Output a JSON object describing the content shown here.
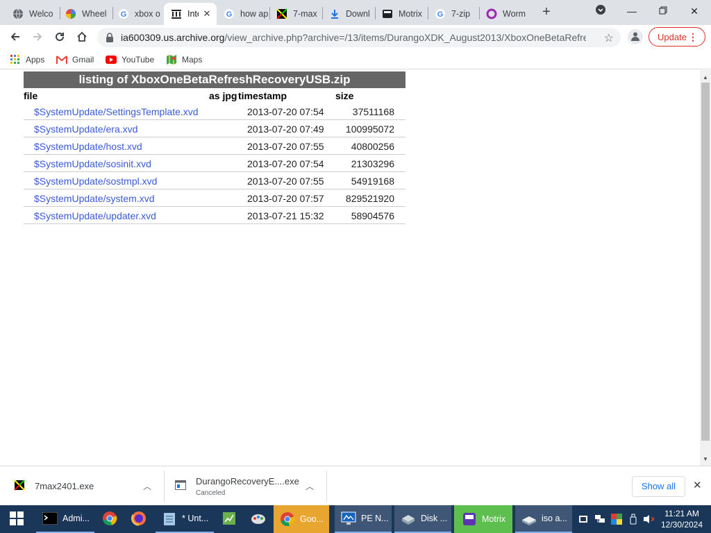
{
  "tabs": [
    {
      "title": "Welco",
      "icon": "globe-icon"
    },
    {
      "title": "Wheel",
      "icon": "wheel-icon"
    },
    {
      "title": "xbox o",
      "icon": "google-icon"
    },
    {
      "title": "Inte",
      "icon": "archive-icon",
      "active": true
    },
    {
      "title": "how ap",
      "icon": "google-icon"
    },
    {
      "title": "7-max",
      "icon": "7max-icon"
    },
    {
      "title": "Downl",
      "icon": "download-icon"
    },
    {
      "title": "Motrix",
      "icon": "motrix-icon"
    },
    {
      "title": "7-zip",
      "icon": "google-icon"
    },
    {
      "title": "Worm",
      "icon": "worm-icon"
    }
  ],
  "address": {
    "host": "ia600309.us.archive.org",
    "path": "/view_archive.php?archive=/13/items/DurangoXDK_August2013/XboxOneBetaRefres..."
  },
  "update_label": "Update",
  "bookmarks": [
    {
      "label": "Apps",
      "icon": "apps-grid-icon"
    },
    {
      "label": "Gmail",
      "icon": "gmail-icon"
    },
    {
      "label": "YouTube",
      "icon": "youtube-icon"
    },
    {
      "label": "Maps",
      "icon": "maps-icon"
    }
  ],
  "listing": {
    "title": "listing of XboxOneBetaRefreshRecoveryUSB.zip",
    "columns": {
      "file": "file",
      "as_jpg": "as jpg",
      "timestamp": "timestamp",
      "size": "size"
    },
    "rows": [
      {
        "file": "$SystemUpdate/SettingsTemplate.xvd",
        "timestamp": "2013-07-20 07:54",
        "size": "37511168"
      },
      {
        "file": "$SystemUpdate/era.xvd",
        "timestamp": "2013-07-20 07:49",
        "size": "100995072"
      },
      {
        "file": "$SystemUpdate/host.xvd",
        "timestamp": "2013-07-20 07:55",
        "size": "40800256"
      },
      {
        "file": "$SystemUpdate/sosinit.xvd",
        "timestamp": "2013-07-20 07:54",
        "size": "21303296"
      },
      {
        "file": "$SystemUpdate/sostmpl.xvd",
        "timestamp": "2013-07-20 07:55",
        "size": "54919168"
      },
      {
        "file": "$SystemUpdate/system.xvd",
        "timestamp": "2013-07-20 07:57",
        "size": "829521920"
      },
      {
        "file": "$SystemUpdate/updater.xvd",
        "timestamp": "2013-07-21 15:32",
        "size": "58904576"
      }
    ]
  },
  "downloads": [
    {
      "name": "7max2401.exe",
      "status": ""
    },
    {
      "name": "DurangoRecoveryE....exe",
      "status": "Canceled"
    }
  ],
  "show_all": "Show all",
  "taskbar": {
    "items": [
      {
        "label": "Admi...",
        "icon": "cmd-icon"
      },
      {
        "label": "",
        "icon": "chrome-icon"
      },
      {
        "label": "",
        "icon": "firefox-icon"
      },
      {
        "label": "* Unt...",
        "icon": "notepad-icon"
      },
      {
        "label": "",
        "icon": "spreadsheet-icon"
      },
      {
        "label": "",
        "icon": "paint-icon"
      },
      {
        "label": "Goo...",
        "icon": "chrome-icon"
      },
      {
        "label": "PE N...",
        "icon": "pe-network-icon"
      },
      {
        "label": "Disk ...",
        "icon": "disk-icon"
      },
      {
        "label": "Motrix",
        "icon": "motrix-icon"
      },
      {
        "label": "iso a...",
        "icon": "iso-icon"
      }
    ],
    "time": "11:21 AM",
    "date": "12/30/2024"
  }
}
